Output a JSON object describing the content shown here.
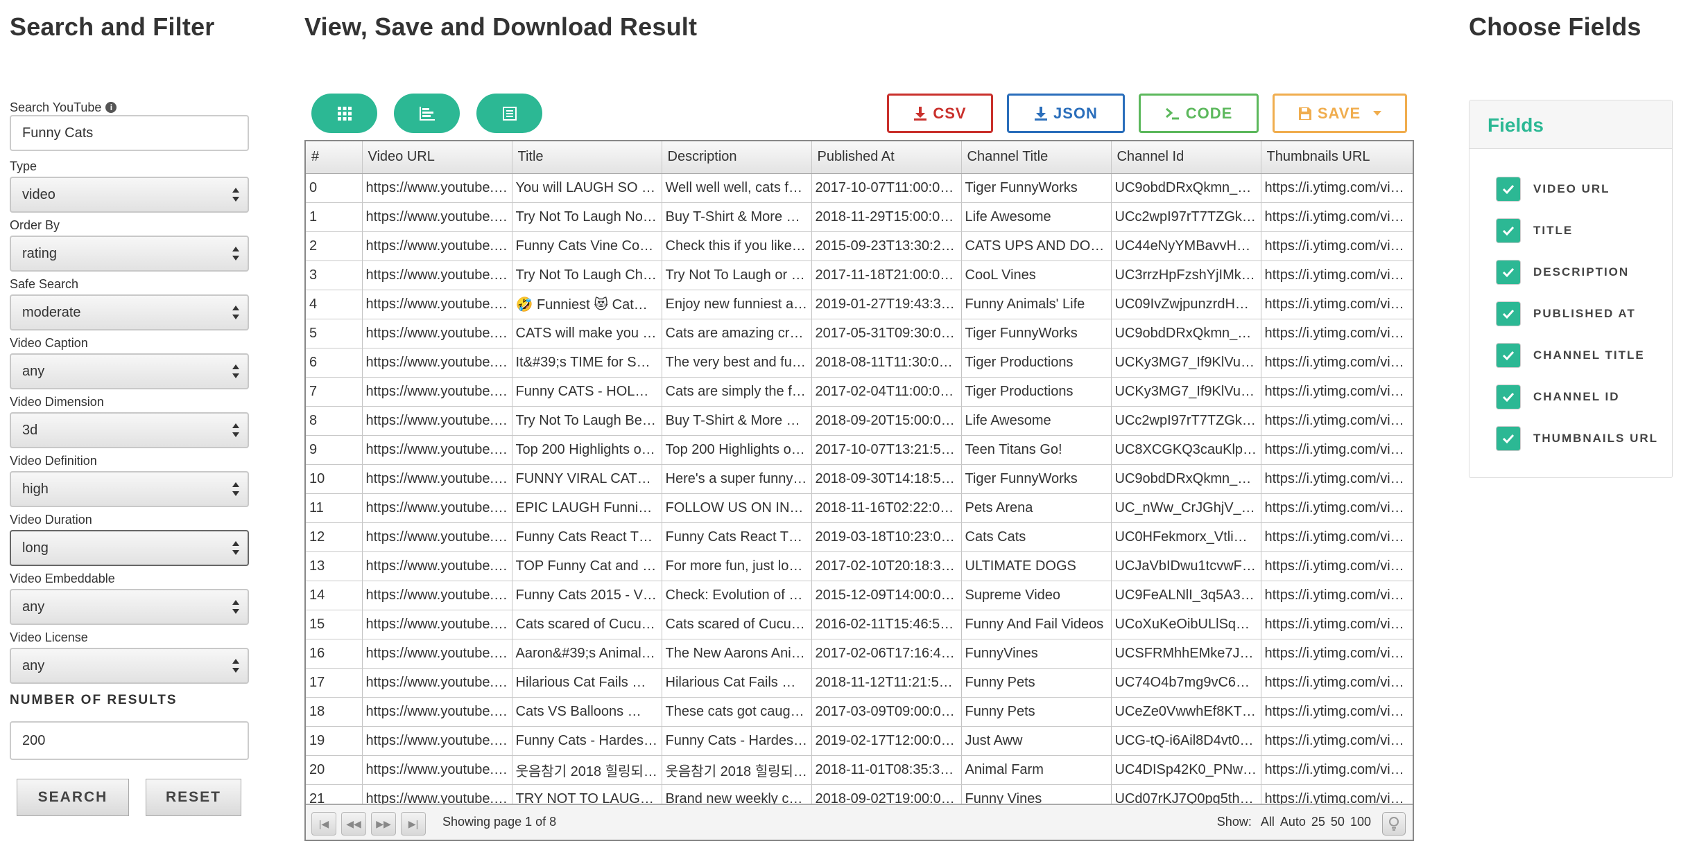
{
  "titles": {
    "left": "Search and Filter",
    "center": "View, Save and Download Result",
    "right": "Choose Fields"
  },
  "filters": {
    "search_label": "Search YouTube",
    "search_value": "Funny Cats",
    "selects": [
      {
        "label": "Type",
        "value": "video"
      },
      {
        "label": "Order By",
        "value": "rating"
      },
      {
        "label": "Safe Search",
        "value": "moderate"
      },
      {
        "label": "Video Caption",
        "value": "any"
      },
      {
        "label": "Video Dimension",
        "value": "3d"
      },
      {
        "label": "Video Definition",
        "value": "high"
      },
      {
        "label": "Video Duration",
        "value": "long"
      },
      {
        "label": "Video Embeddable",
        "value": "any"
      },
      {
        "label": "Video License",
        "value": "any"
      }
    ],
    "num_results_label": "NUMBER OF RESULTS",
    "num_results_value": "200",
    "search_button": "SEARCH",
    "reset_button": "RESET"
  },
  "toolbar": {
    "view_icons": [
      "grid-view-icon",
      "bar-view-icon",
      "list-view-icon"
    ],
    "csv": "CSV",
    "json": "JSON",
    "code": "CODE",
    "save": "SAVE",
    "colors": {
      "csv": "#c9302c",
      "json": "#2a6ebb",
      "code": "#5cb85c",
      "save": "#f0ad4e",
      "accent": "#2cb894"
    }
  },
  "table": {
    "columns": [
      "#",
      "Video URL",
      "Title",
      "Description",
      "Published At",
      "Channel Title",
      "Channel Id",
      "Thumbnails URL"
    ],
    "rows": [
      [
        "0",
        "https://www.youtube.…",
        "You will LAUGH SO …",
        "Well well well, cats f…",
        "2017-10-07T11:00:0…",
        "Tiger FunnyWorks",
        "UC9obdDRxQkmn_…",
        "https://i.ytimg.com/vi…"
      ],
      [
        "1",
        "https://www.youtube.…",
        "Try Not To Laugh No…",
        "Buy T-Shirt & More …",
        "2018-11-29T15:00:0…",
        "Life Awesome",
        "UCc2wpI97rT7TZGk…",
        "https://i.ytimg.com/vi…"
      ],
      [
        "2",
        "https://www.youtube.…",
        "Funny Cats Vine Co…",
        "Check this if you like…",
        "2015-09-23T13:30:2…",
        "CATS UPS AND DO…",
        "UC44eNyYMBavvH…",
        "https://i.ytimg.com/vi…"
      ],
      [
        "3",
        "https://www.youtube.…",
        "Try Not To Laugh Ch…",
        "Try Not To Laugh or …",
        "2017-11-18T21:00:0…",
        "CooL Vines",
        "UC3rrzHpFzshYjIMk…",
        "https://i.ytimg.com/vi…"
      ],
      [
        "4",
        "https://www.youtube.…",
        "🤣 Funniest 😻 Cat…",
        "Enjoy new funniest a…",
        "2019-01-27T19:43:3…",
        "Funny Animals' Life",
        "UC09IvZwjpunzrdH…",
        "https://i.ytimg.com/vi…"
      ],
      [
        "5",
        "https://www.youtube.…",
        "CATS will make you …",
        "Cats are amazing cr…",
        "2017-05-31T09:30:0…",
        "Tiger FunnyWorks",
        "UC9obdDRxQkmn_…",
        "https://i.ytimg.com/vi…"
      ],
      [
        "6",
        "https://www.youtube.…",
        "It&#39;s TIME for S…",
        "The very best and fu…",
        "2018-08-11T11:30:0…",
        "Tiger Productions",
        "UCKy3MG7_If9KlVu…",
        "https://i.ytimg.com/vi…"
      ],
      [
        "7",
        "https://www.youtube.…",
        "Funny CATS - HOL…",
        "Cats are simply the f…",
        "2017-02-04T11:00:0…",
        "Tiger Productions",
        "UCKy3MG7_If9KlVu…",
        "https://i.ytimg.com/vi…"
      ],
      [
        "8",
        "https://www.youtube.…",
        "Try Not To Laugh Be…",
        "Buy T-Shirt & More …",
        "2018-09-20T15:00:0…",
        "Life Awesome",
        "UCc2wpI97rT7TZGk…",
        "https://i.ytimg.com/vi…"
      ],
      [
        "9",
        "https://www.youtube.…",
        "Top 200 Highlights o…",
        "Top 200 Highlights o…",
        "2017-10-07T13:21:5…",
        "Teen Titans Go!",
        "UC8XCGKQ3cauKlp…",
        "https://i.ytimg.com/vi…"
      ],
      [
        "10",
        "https://www.youtube.…",
        "FUNNY VIRAL CAT…",
        "Here's a super funny…",
        "2018-09-30T14:18:5…",
        "Tiger FunnyWorks",
        "UC9obdDRxQkmn_…",
        "https://i.ytimg.com/vi…"
      ],
      [
        "11",
        "https://www.youtube.…",
        "EPIC LAUGH Funni…",
        "FOLLOW US ON IN…",
        "2018-11-16T02:22:0…",
        "Pets Arena",
        "UC_nWw_CrJGhjV_…",
        "https://i.ytimg.com/vi…"
      ],
      [
        "12",
        "https://www.youtube.…",
        "Funny Cats React T…",
        "Funny Cats React T…",
        "2019-03-18T10:23:0…",
        "Cats Cats",
        "UC0HFekmorx_Vtli…",
        "https://i.ytimg.com/vi…"
      ],
      [
        "13",
        "https://www.youtube.…",
        "TOP Funny Cat and …",
        "For more fun, just lo…",
        "2017-02-10T20:18:3…",
        "ULTIMATE DOGS",
        "UCJaVbIDwu1tcvwF…",
        "https://i.ytimg.com/vi…"
      ],
      [
        "14",
        "https://www.youtube.…",
        "Funny Cats 2015 - V…",
        "Check: Evolution of …",
        "2015-12-09T14:00:0…",
        "Supreme Video",
        "UC9FeALNlI_3q5A3…",
        "https://i.ytimg.com/vi…"
      ],
      [
        "15",
        "https://www.youtube.…",
        "Cats scared of Cucu…",
        "Cats scared of Cucu…",
        "2016-02-11T15:46:5…",
        "Funny And Fail Videos",
        "UCoXuKeOibULlSq…",
        "https://i.ytimg.com/vi…"
      ],
      [
        "16",
        "https://www.youtube.…",
        "Aaron&#39;s Animal…",
        "The New Aarons Ani…",
        "2017-02-06T17:16:4…",
        "FunnyVines",
        "UCSFRMhhEMke7J…",
        "https://i.ytimg.com/vi…"
      ],
      [
        "17",
        "https://www.youtube.…",
        "Hilarious Cat Fails …",
        "Hilarious Cat Fails …",
        "2018-11-12T11:21:5…",
        "Funny Pets",
        "UC74O4b7mg9vC6p…",
        "https://i.ytimg.com/vi…"
      ],
      [
        "18",
        "https://www.youtube.…",
        "Cats VS Balloons …",
        "These cats got caug…",
        "2017-03-09T09:00:0…",
        "Funny Pets",
        "UCeZe0VwwhEf8KT…",
        "https://i.ytimg.com/vi…"
      ],
      [
        "19",
        "https://www.youtube.…",
        "Funny Cats - Hardes…",
        "Funny Cats - Hardes…",
        "2019-02-17T12:00:0…",
        "Just Aww",
        "UCG-tQ-i6Ail8D4vt0…",
        "https://i.ytimg.com/vi…"
      ],
      [
        "20",
        "https://www.youtube.…",
        "웃음참기 2018 힐링되…",
        "웃음참기 2018 힐링되…",
        "2018-11-01T08:35:3…",
        "Animal Farm",
        "UC4DISp42K0_PNw…",
        "https://i.ytimg.com/vi…"
      ],
      [
        "21",
        "https://www.youtube.…",
        "TRY NOT TO LAUG…",
        "Brand new weekly c…",
        "2018-09-02T19:00:0…",
        "Funny Vines",
        "UCd07rKJ7Q0pg5th…",
        "https://i.ytimg.com/vi…"
      ]
    ],
    "footer": {
      "page_status": "Showing page 1 of 8",
      "show_label": "Show:",
      "show_options": [
        "All",
        "Auto",
        "25",
        "50",
        "100"
      ]
    }
  },
  "fields": {
    "header": "Fields",
    "items": [
      "VIDEO URL",
      "TITLE",
      "DESCRIPTION",
      "PUBLISHED AT",
      "CHANNEL TITLE",
      "CHANNEL ID",
      "THUMBNAILS URL"
    ]
  }
}
